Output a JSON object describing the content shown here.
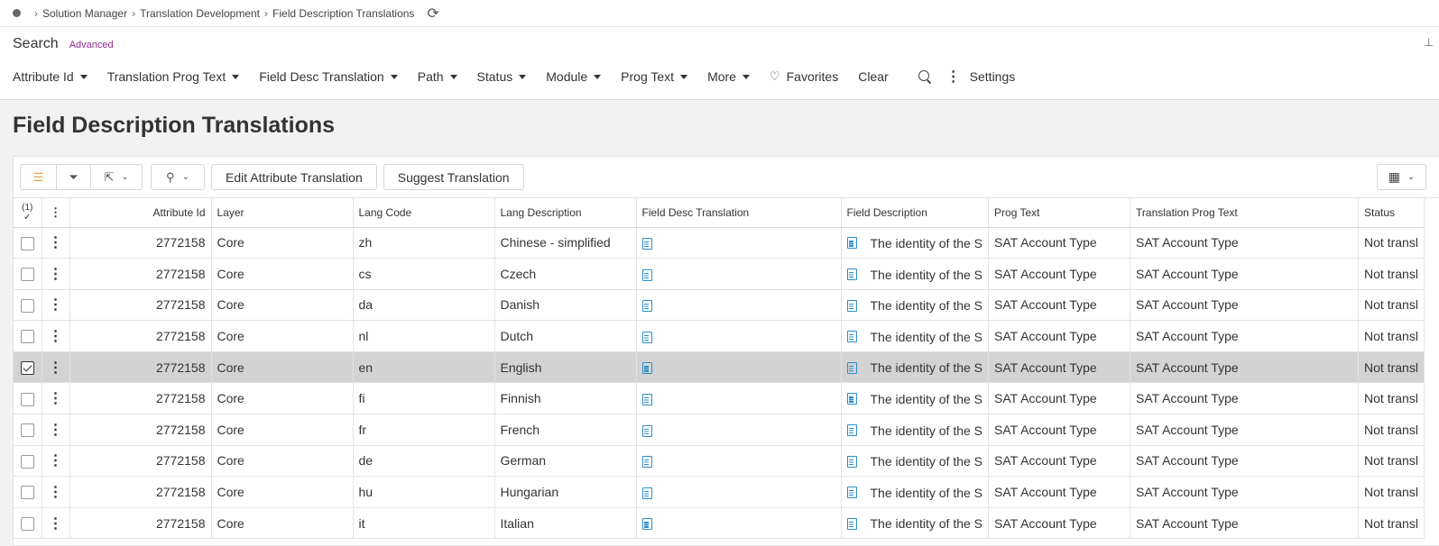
{
  "breadcrumb": [
    "Solution Manager",
    "Translation Development",
    "Field Description Translations"
  ],
  "search": {
    "title": "Search",
    "advanced": "Advanced"
  },
  "filters": [
    {
      "label": "Attribute Id",
      "dropdown": true
    },
    {
      "label": "Translation Prog Text",
      "dropdown": true
    },
    {
      "label": "Field Desc Translation",
      "dropdown": true
    },
    {
      "label": "Path",
      "dropdown": true
    },
    {
      "label": "Status",
      "dropdown": true
    },
    {
      "label": "Module",
      "dropdown": true
    },
    {
      "label": "Prog Text",
      "dropdown": true
    },
    {
      "label": "More",
      "dropdown": true
    }
  ],
  "favorites": "Favorites",
  "clear": "Clear",
  "settings": "Settings",
  "page_title": "Field Description Translations",
  "toolbar": {
    "edit_attribute_translation": "Edit Attribute Translation",
    "suggest_translation": "Suggest Translation"
  },
  "table": {
    "selected_count": "(1)",
    "columns": [
      "Attribute Id",
      "Layer",
      "Lang Code",
      "Lang Description",
      "Field Desc Translation",
      "Field Description",
      "Prog Text",
      "Translation Prog Text",
      "Status"
    ],
    "rows": [
      {
        "attribute_id": "2772158",
        "layer": "Core",
        "lang_code": "zh",
        "lang_desc": "Chinese - simplified",
        "field_desc": "The identity of the S",
        "prog_text": "SAT Account Type",
        "trans_prog_text": "SAT Account Type",
        "status": "Not transl",
        "selected": false
      },
      {
        "attribute_id": "2772158",
        "layer": "Core",
        "lang_code": "cs",
        "lang_desc": "Czech",
        "field_desc": "The identity of the S",
        "prog_text": "SAT Account Type",
        "trans_prog_text": "SAT Account Type",
        "status": "Not transl",
        "selected": false
      },
      {
        "attribute_id": "2772158",
        "layer": "Core",
        "lang_code": "da",
        "lang_desc": "Danish",
        "field_desc": "The identity of the S",
        "prog_text": "SAT Account Type",
        "trans_prog_text": "SAT Account Type",
        "status": "Not transl",
        "selected": false
      },
      {
        "attribute_id": "2772158",
        "layer": "Core",
        "lang_code": "nl",
        "lang_desc": "Dutch",
        "field_desc": "The identity of the S",
        "prog_text": "SAT Account Type",
        "trans_prog_text": "SAT Account Type",
        "status": "Not transl",
        "selected": false
      },
      {
        "attribute_id": "2772158",
        "layer": "Core",
        "lang_code": "en",
        "lang_desc": "English",
        "field_desc": "The identity of the S",
        "prog_text": "SAT Account Type",
        "trans_prog_text": "SAT Account Type",
        "status": "Not transl",
        "selected": true
      },
      {
        "attribute_id": "2772158",
        "layer": "Core",
        "lang_code": "fi",
        "lang_desc": "Finnish",
        "field_desc": "The identity of the S",
        "prog_text": "SAT Account Type",
        "trans_prog_text": "SAT Account Type",
        "status": "Not transl",
        "selected": false
      },
      {
        "attribute_id": "2772158",
        "layer": "Core",
        "lang_code": "fr",
        "lang_desc": "French",
        "field_desc": "The identity of the S",
        "prog_text": "SAT Account Type",
        "trans_prog_text": "SAT Account Type",
        "status": "Not transl",
        "selected": false
      },
      {
        "attribute_id": "2772158",
        "layer": "Core",
        "lang_code": "de",
        "lang_desc": "German",
        "field_desc": "The identity of the S",
        "prog_text": "SAT Account Type",
        "trans_prog_text": "SAT Account Type",
        "status": "Not transl",
        "selected": false
      },
      {
        "attribute_id": "2772158",
        "layer": "Core",
        "lang_code": "hu",
        "lang_desc": "Hungarian",
        "field_desc": "The identity of the S",
        "prog_text": "SAT Account Type",
        "trans_prog_text": "SAT Account Type",
        "status": "Not transl",
        "selected": false
      },
      {
        "attribute_id": "2772158",
        "layer": "Core",
        "lang_code": "it",
        "lang_desc": "Italian",
        "field_desc": "The identity of the S",
        "prog_text": "SAT Account Type",
        "trans_prog_text": "SAT Account Type",
        "status": "Not transl",
        "selected": false
      }
    ]
  },
  "colors": {
    "accent_advanced": "#8c2c8c",
    "doc_icon": "#2e8ec8",
    "selected_row": "#d3d3d3"
  }
}
